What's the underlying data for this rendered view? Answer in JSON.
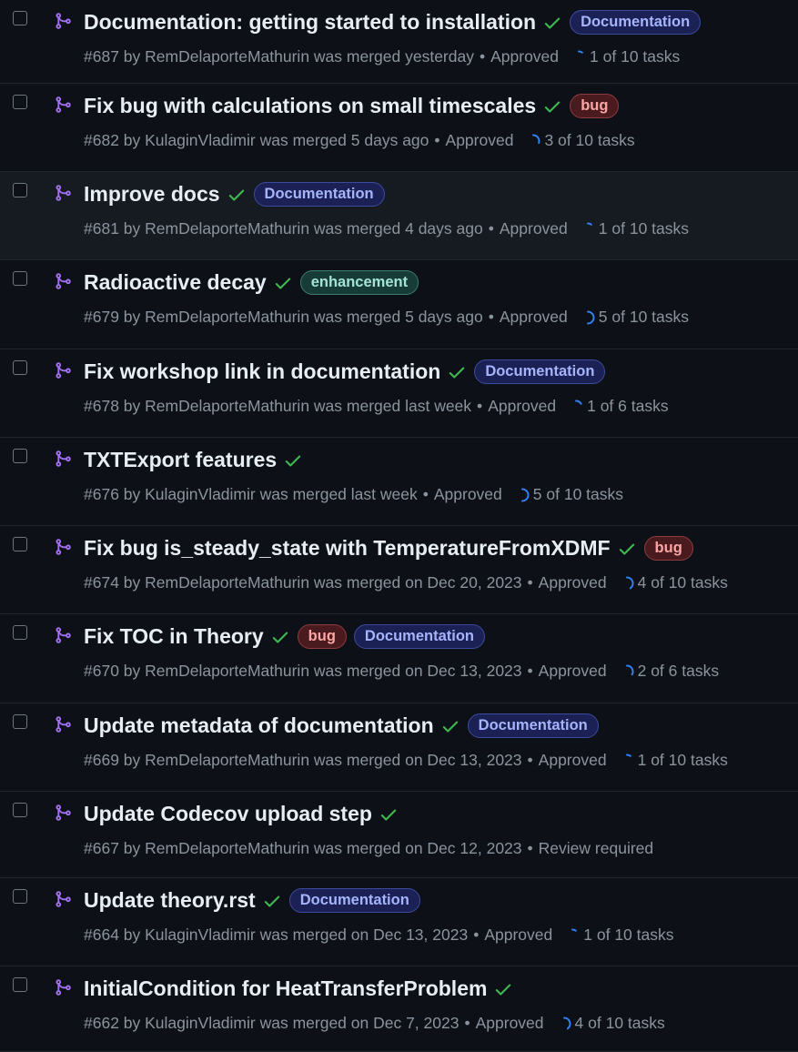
{
  "accent": {
    "merged": "#a371f7",
    "check": "#3fb950",
    "progress": "#2f81f7"
  },
  "pull_requests": [
    {
      "title": "Documentation: getting started to installation",
      "labels": [
        "Documentation"
      ],
      "meta": "#687 by RemDelaporteMathurin was merged yesterday",
      "review": "Approved",
      "tasks": "1 of 10 tasks",
      "tasks_done": 1,
      "tasks_total": 10,
      "hover": false
    },
    {
      "title": "Fix bug with calculations on small timescales",
      "labels": [
        "bug"
      ],
      "meta": "#682 by KulaginVladimir was merged 5 days ago",
      "review": "Approved",
      "tasks": "3 of 10 tasks",
      "tasks_done": 3,
      "tasks_total": 10,
      "hover": false
    },
    {
      "title": "Improve docs",
      "labels": [
        "Documentation"
      ],
      "meta": "#681 by RemDelaporteMathurin was merged 4 days ago",
      "review": "Approved",
      "tasks": "1 of 10 tasks",
      "tasks_done": 1,
      "tasks_total": 10,
      "hover": true
    },
    {
      "title": "Radioactive decay",
      "labels": [
        "enhancement"
      ],
      "meta": "#679 by RemDelaporteMathurin was merged 5 days ago",
      "review": "Approved",
      "tasks": "5 of 10 tasks",
      "tasks_done": 5,
      "tasks_total": 10,
      "hover": false
    },
    {
      "title": "Fix workshop link in documentation",
      "labels": [
        "Documentation"
      ],
      "meta": "#678 by RemDelaporteMathurin was merged last week",
      "review": "Approved",
      "tasks": "1 of 6 tasks",
      "tasks_done": 1,
      "tasks_total": 6,
      "hover": false
    },
    {
      "title": "TXTExport features",
      "labels": [],
      "meta": "#676 by KulaginVladimir was merged last week",
      "review": "Approved",
      "tasks": "5 of 10 tasks",
      "tasks_done": 5,
      "tasks_total": 10,
      "hover": false
    },
    {
      "title": "Fix bug is_steady_state with TemperatureFromXDMF",
      "labels": [
        "bug"
      ],
      "meta": "#674 by RemDelaporteMathurin was merged on Dec 20, 2023",
      "review": "Approved",
      "tasks": "4 of 10 tasks",
      "tasks_done": 4,
      "tasks_total": 10,
      "hover": false
    },
    {
      "title": "Fix TOC in Theory",
      "labels": [
        "bug",
        "Documentation"
      ],
      "meta": "#670 by RemDelaporteMathurin was merged on Dec 13, 2023",
      "review": "Approved",
      "tasks": "2 of 6 tasks",
      "tasks_done": 2,
      "tasks_total": 6,
      "hover": false
    },
    {
      "title": "Update metadata of documentation",
      "labels": [
        "Documentation"
      ],
      "meta": "#669 by RemDelaporteMathurin was merged on Dec 13, 2023",
      "review": "Approved",
      "tasks": "1 of 10 tasks",
      "tasks_done": 1,
      "tasks_total": 10,
      "hover": false
    },
    {
      "title": "Update Codecov upload step",
      "labels": [],
      "meta": "#667 by RemDelaporteMathurin was merged on Dec 12, 2023",
      "review": "Review required",
      "tasks": "",
      "tasks_done": 0,
      "tasks_total": 0,
      "hover": false
    },
    {
      "title": "Update theory.rst",
      "labels": [
        "Documentation"
      ],
      "meta": "#664 by KulaginVladimir was merged on Dec 13, 2023",
      "review": "Approved",
      "tasks": "1 of 10 tasks",
      "tasks_done": 1,
      "tasks_total": 10,
      "hover": false
    },
    {
      "title": "InitialCondition for HeatTransferProblem",
      "labels": [],
      "meta": "#662 by KulaginVladimir was merged on Dec 7, 2023",
      "review": "Approved",
      "tasks": "4 of 10 tasks",
      "tasks_done": 4,
      "tasks_total": 10,
      "hover": false
    }
  ]
}
